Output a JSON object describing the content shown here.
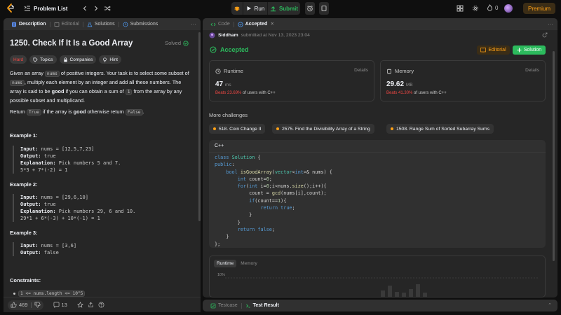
{
  "topbar": {
    "problem_list_label": "Problem List",
    "run_label": "Run",
    "submit_label": "Submit",
    "streak_count": "0",
    "premium_label": "Premium"
  },
  "left_tabs": [
    {
      "label": "Description",
      "icon": "description-icon"
    },
    {
      "label": "Editorial",
      "icon": "book-icon"
    },
    {
      "label": "Solutions",
      "icon": "flask-icon"
    },
    {
      "label": "Submissions",
      "icon": "history-icon"
    }
  ],
  "problem": {
    "title": "1250. Check If It Is a Good Array",
    "status": "Solved",
    "tags": [
      "Hard",
      "Topics",
      "Companies",
      "Hint"
    ],
    "desc1_a": "Given an array ",
    "desc1_code1": "nums",
    "desc1_b": " of positive integers. Your task is to select some subset of ",
    "desc1_code2": "nums",
    "desc1_c": ", multiply each element by an integer and add all these numbers. The array is said to be ",
    "desc1_bold": "good",
    "desc1_d": " if you can obtain a sum of ",
    "desc1_code3": "1",
    "desc1_e": " from the array by any possible subset and multiplicand.",
    "desc2_a": "Return ",
    "desc2_code1": "True",
    "desc2_b": " if the array is ",
    "desc2_bold": "good",
    "desc2_c": " otherwise return ",
    "desc2_code2": "False",
    "desc2_d": ".",
    "examples": [
      {
        "title": "Example 1:",
        "input_label": "Input:",
        "input": " nums = [12,5,7,23]",
        "output_label": "Output:",
        "output": " true",
        "expl_label": "Explanation:",
        "expl": " Pick numbers 5 and 7.",
        "expl2": "5*3 + 7*(-2) = 1"
      },
      {
        "title": "Example 2:",
        "input_label": "Input:",
        "input": " nums = [29,6,10]",
        "output_label": "Output:",
        "output": " true",
        "expl_label": "Explanation:",
        "expl": " Pick numbers 29, 6 and 10.",
        "expl2": "29*1 + 6*(-3) + 10*(-1) = 1"
      },
      {
        "title": "Example 3:",
        "input_label": "Input:",
        "input": " nums = [3,6]",
        "output_label": "Output:",
        "output": " false"
      }
    ],
    "constraints_title": "Constraints:",
    "constraint1": "1 <= nums.length <= 10^5"
  },
  "left_footer": {
    "likes": "469",
    "comments": "13"
  },
  "right_tabs": [
    {
      "label": "Code",
      "icon": "code-icon"
    },
    {
      "label": "Accepted",
      "icon": "check-circle-icon"
    }
  ],
  "submission": {
    "user": "Siddham",
    "submitted_text": "submitted at Nov 13, 2023 23:04",
    "status": "Accepted",
    "editorial_btn": "Editorial",
    "solution_btn": "Solution",
    "runtime": {
      "label": "Runtime",
      "details": "Details",
      "value": "47",
      "unit": "ms",
      "beats_pct": "Beats 23.69%",
      "beats_rest": " of users with C++"
    },
    "memory": {
      "label": "Memory",
      "details": "Details",
      "value": "29.62",
      "unit": "MB",
      "beats_pct": "Beats 41.30%",
      "beats_rest": " of users with C++"
    }
  },
  "more_challenges": {
    "title": "More challenges",
    "items": [
      "518. Coin Change II",
      "2575. Find the Divisibility Array of a String",
      "1508. Range Sum of Sorted Subarray Sums"
    ]
  },
  "code": {
    "language": "C++"
  },
  "chart_area": {
    "tabs": [
      "Runtime",
      "Memory"
    ],
    "top_label": "10%"
  },
  "bottom_tabs": [
    "Testcase",
    "Test Result"
  ],
  "colors": {
    "accent_green": "#2cbb5d",
    "accent_orange": "#ffa116",
    "hard_red": "#ef4743"
  }
}
